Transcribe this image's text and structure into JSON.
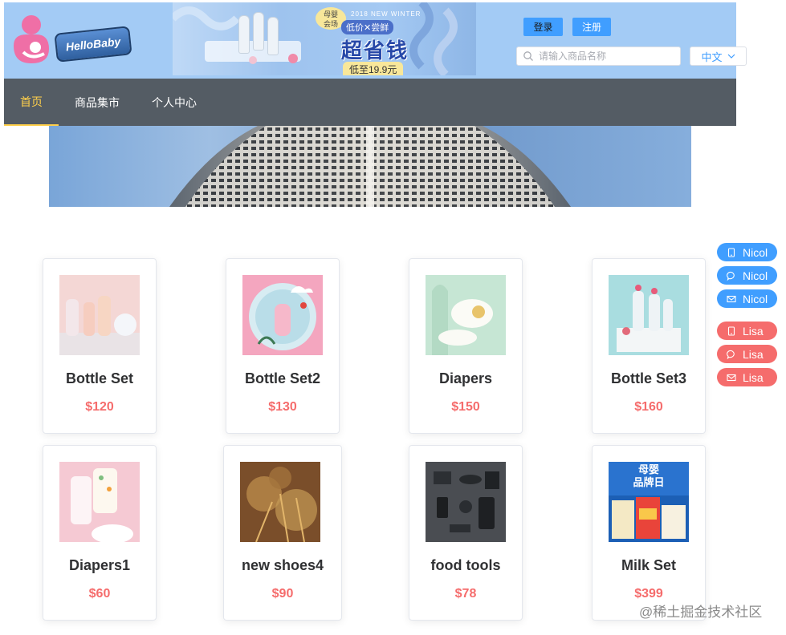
{
  "header": {
    "logo_text": "HelloBaby",
    "ad": {
      "tag": "母婴\n会场",
      "subtitle": "2018 NEW WINTER",
      "line2": "低价✕尝鲜",
      "main": "超省钱",
      "bottom": "低至19.9元"
    },
    "login_label": "登录",
    "register_label": "注册",
    "search_placeholder": "请输入商品名称",
    "search_value": "",
    "language": "中文",
    "accent_color": "#409eff",
    "header_bg": "#a3cbf5"
  },
  "nav": {
    "items": [
      {
        "label": "首页",
        "active": true
      },
      {
        "label": "商品集市",
        "active": false
      },
      {
        "label": "个人中心",
        "active": false
      }
    ],
    "bg_color": "#545c64",
    "active_color": "#ffd04b"
  },
  "products": [
    {
      "name": "Bottle Set",
      "price": "$120"
    },
    {
      "name": "Bottle Set2",
      "price": "$130"
    },
    {
      "name": "Diapers",
      "price": "$150"
    },
    {
      "name": "Bottle Set3",
      "price": "$160"
    },
    {
      "name": "Diapers1",
      "price": "$60"
    },
    {
      "name": "new shoes4",
      "price": "$90"
    },
    {
      "name": "food tools",
      "price": "$78"
    },
    {
      "name": "Milk Set",
      "price": "$399"
    }
  ],
  "contacts": [
    {
      "name": "Nicol",
      "icon": "phone-icon",
      "color": "#409eff"
    },
    {
      "name": "Nicol",
      "icon": "chat-icon",
      "color": "#409eff"
    },
    {
      "name": "Nicol",
      "icon": "mail-icon",
      "color": "#409eff"
    },
    {
      "name": "Lisa",
      "icon": "phone-icon",
      "color": "#f56c6c"
    },
    {
      "name": "Lisa",
      "icon": "chat-icon",
      "color": "#f56c6c"
    },
    {
      "name": "Lisa",
      "icon": "mail-icon",
      "color": "#f56c6c"
    }
  ],
  "milk_thumb_text": "母婴\n品牌日",
  "watermark": "@稀土掘金技术社区",
  "price_color": "#f56c6c"
}
